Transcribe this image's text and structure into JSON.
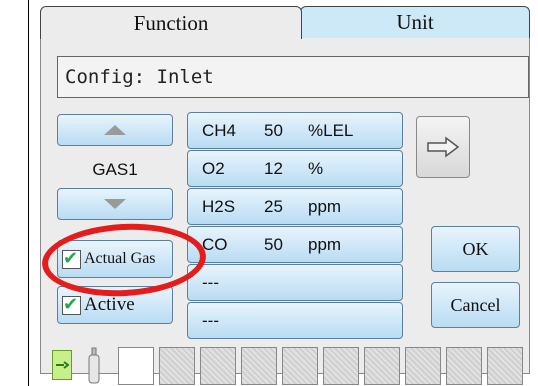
{
  "tabs": {
    "function_label": "Function",
    "unit_label": "Unit"
  },
  "config": {
    "text": "Config: Inlet"
  },
  "gas_selector": {
    "label": "GAS1"
  },
  "checkboxes": {
    "actual_gas_label": "Actual Gas",
    "actual_gas_checked": true,
    "active_label": "Active",
    "active_checked": true
  },
  "gas_list": [
    {
      "name": "CH4",
      "value": "50",
      "unit": "%LEL"
    },
    {
      "name": "O2",
      "value": "12",
      "unit": "%"
    },
    {
      "name": "H2S",
      "value": "25",
      "unit": "ppm"
    },
    {
      "name": "CO",
      "value": "50",
      "unit": "ppm"
    },
    {
      "name": "---",
      "value": "",
      "unit": ""
    },
    {
      "name": "---",
      "value": "",
      "unit": ""
    }
  ],
  "buttons": {
    "ok_label": "OK",
    "cancel_label": "Cancel"
  },
  "colors": {
    "tab_active": "#ececec",
    "tab_inactive": "#cde9f7",
    "button_top": "#e8f4fc",
    "button_bottom": "#b9dcf3",
    "check_green": "#22a84a",
    "highlight_red": "#e41c1c",
    "battery_green": "#c8f08a"
  },
  "icons": {
    "next": "right-arrow-icon",
    "up": "up-triangle-icon",
    "down": "down-triangle-icon",
    "battery": "battery-icon",
    "cylinder": "gas-cylinder-icon"
  }
}
